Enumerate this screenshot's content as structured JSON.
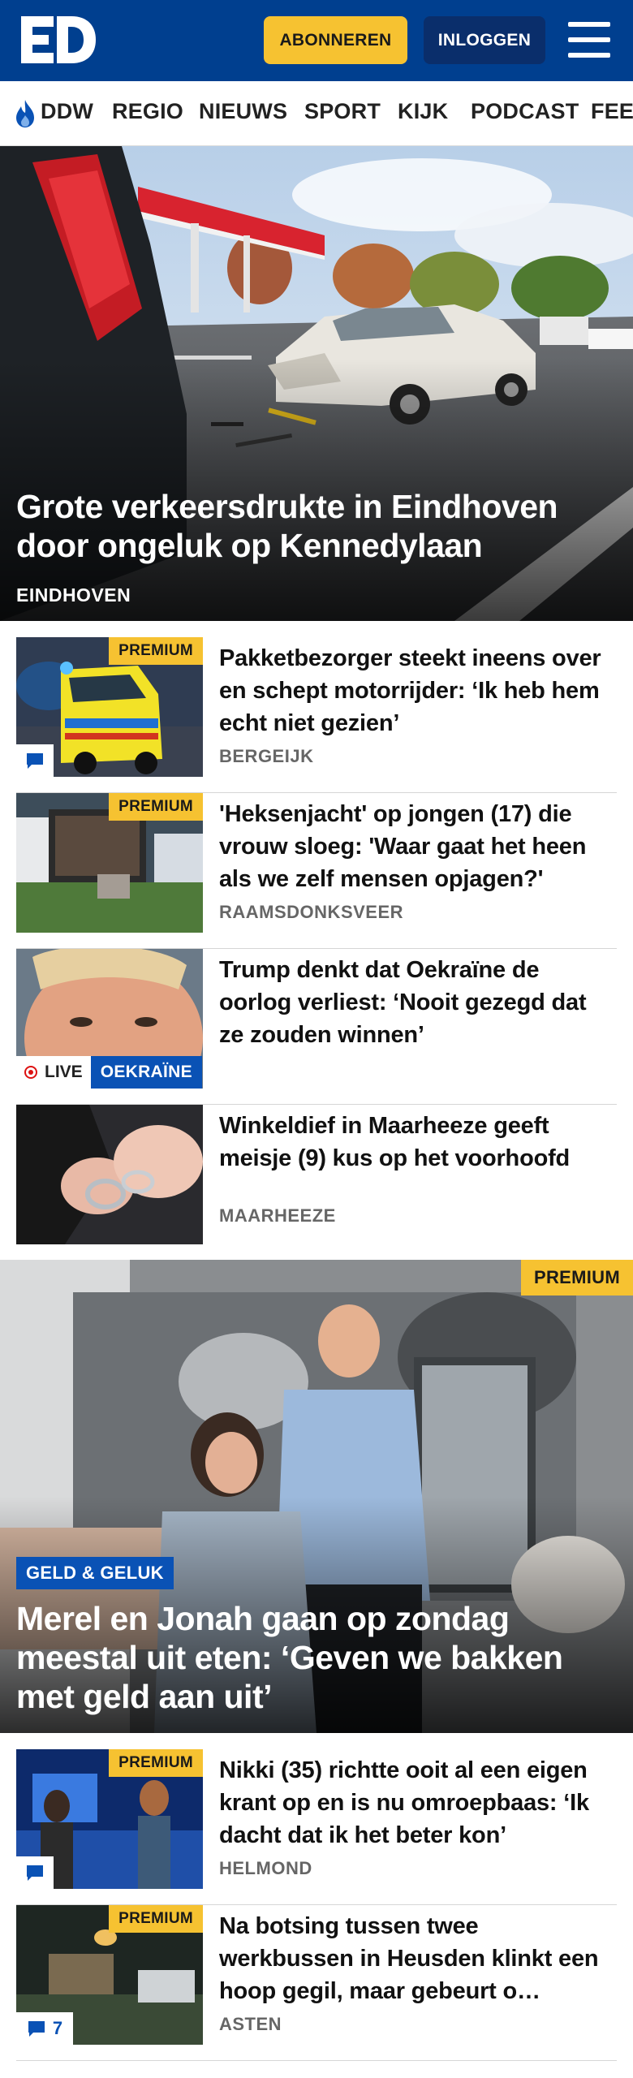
{
  "header": {
    "logo_text": "ED",
    "subscribe_label": "ABONNEREN",
    "login_label": "INLOGGEN",
    "menu_icon": "hamburger-menu-icon"
  },
  "nav": {
    "items": [
      {
        "label": "DDW",
        "icon": "flame-icon"
      },
      {
        "label": "REGIO"
      },
      {
        "label": "NIEUWS"
      },
      {
        "label": "SPORT"
      },
      {
        "label": "KIJK"
      },
      {
        "label": "PODCAST"
      },
      {
        "label": "FEE"
      }
    ]
  },
  "hero": {
    "title": "Grote verkeersdrukte in Eindhoven door ongeluk op Kennedylaan",
    "location": "EINDHOVEN"
  },
  "articles": [
    {
      "title": "Pakketbezorger steekt ineens over en schept motorrijder: ‘Ik heb hem echt niet gezien’",
      "location": "BERGEIJK",
      "badge": "PREMIUM",
      "comments_icon": "comment-icon"
    },
    {
      "title": "'Heksenjacht' op jongen (17) die vrouw sloeg: 'Waar gaat het heen als we zelf mensen opjagen?'",
      "location": "RAAMSDONKSVEER",
      "badge": "PREMIUM"
    },
    {
      "title": "Trump denkt dat Oekraïne de oorlog verliest: ‘Nooit gezegd dat ze zouden winnen’",
      "live_label": "LIVE",
      "tag": "OEKRAÏNE"
    },
    {
      "title": "Winkeldief in Maarheeze geeft meisje (9) kus op het voorhoofd",
      "location": "MAARHEEZE"
    }
  ],
  "feature": {
    "badge": "PREMIUM",
    "tag": "GELD & GELUK",
    "title": "Merel en Jonah gaan op zondag meestal uit eten: ‘Geven we bakken met geld aan uit’"
  },
  "articles2": [
    {
      "title": "Nikki (35) richtte ooit al een eigen krant op en is nu omroepbaas: ‘Ik dacht dat ik het beter kon’",
      "location": "HELMOND",
      "badge": "PREMIUM",
      "comments_icon": "comment-icon"
    },
    {
      "title": "Na botsing tussen twee werkbussen in Heusden klinkt een hoop gegil, maar gebeurt o…",
      "location": "ASTEN",
      "badge": "PREMIUM",
      "comment_count": "7"
    }
  ],
  "colors": {
    "brand_blue": "#003f8f",
    "premium_yellow": "#f6c231",
    "tag_blue": "#0a52b5"
  }
}
